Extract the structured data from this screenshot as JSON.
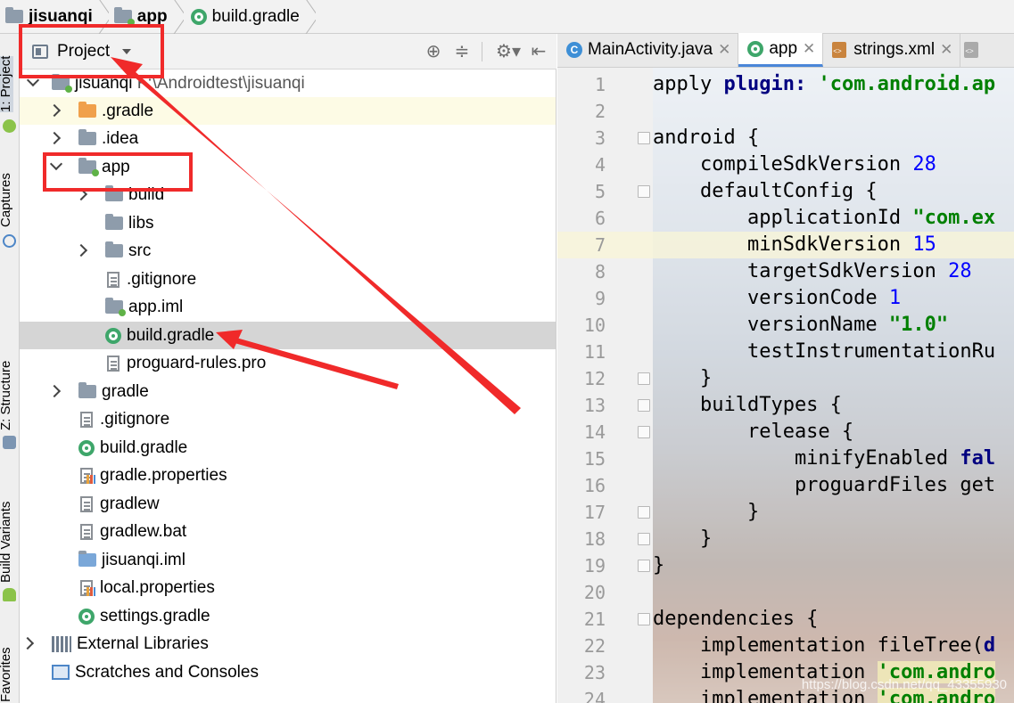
{
  "breadcrumb": [
    "jisuanqi",
    "app",
    "build.gradle"
  ],
  "stripe": {
    "tabs": [
      "1: Project",
      "Captures",
      "Z: Structure",
      "Build Variants",
      "Favorites"
    ]
  },
  "project_panel": {
    "view_selector": "Project",
    "tree": [
      {
        "label": "jisuanqi",
        "path": "F:\\Androidtest\\jisuanqi",
        "icon": "module-folder-icon"
      },
      {
        "label": ".gradle",
        "icon": "folder-orange-icon"
      },
      {
        "label": ".idea",
        "icon": "folder-icon"
      },
      {
        "label": "app",
        "icon": "module-folder-icon"
      },
      {
        "label": "build",
        "icon": "folder-icon"
      },
      {
        "label": "libs",
        "icon": "folder-icon"
      },
      {
        "label": "src",
        "icon": "folder-icon"
      },
      {
        "label": ".gitignore",
        "icon": "text-file-icon"
      },
      {
        "label": "app.iml",
        "icon": "iml-file-icon"
      },
      {
        "label": "build.gradle",
        "icon": "gradle-icon"
      },
      {
        "label": "proguard-rules.pro",
        "icon": "text-file-icon"
      },
      {
        "label": "gradle",
        "icon": "folder-icon"
      },
      {
        "label": ".gitignore",
        "icon": "text-file-icon"
      },
      {
        "label": "build.gradle",
        "icon": "gradle-icon"
      },
      {
        "label": "gradle.properties",
        "icon": "properties-file-icon"
      },
      {
        "label": "gradlew",
        "icon": "text-file-icon"
      },
      {
        "label": "gradlew.bat",
        "icon": "text-file-icon"
      },
      {
        "label": "jisuanqi.iml",
        "icon": "iml-file-icon"
      },
      {
        "label": "local.properties",
        "icon": "properties-file-icon"
      },
      {
        "label": "settings.gradle",
        "icon": "gradle-icon"
      },
      {
        "label": "External Libraries",
        "icon": "libraries-icon"
      },
      {
        "label": "Scratches and Consoles",
        "icon": "scratches-icon"
      }
    ]
  },
  "editor": {
    "tabs": [
      {
        "label": "MainActivity.java",
        "icon": "java-class-icon"
      },
      {
        "label": "app",
        "icon": "gradle-icon"
      },
      {
        "label": "strings.xml",
        "icon": "xml-file-icon"
      }
    ],
    "line_numbers": [
      "1",
      "2",
      "3",
      "4",
      "5",
      "6",
      "7",
      "8",
      "9",
      "10",
      "11",
      "12",
      "13",
      "14",
      "15",
      "16",
      "17",
      "18",
      "19",
      "20",
      "21",
      "22",
      "23",
      "24"
    ],
    "code": {
      "l1_a": "apply ",
      "l1_b": "plugin: ",
      "l1_c": "'com.android.ap",
      "l3": "android {",
      "l4_a": "    compileSdkVersion ",
      "l4_b": "28",
      "l5": "    defaultConfig {",
      "l6_a": "        applicationId ",
      "l6_b": "\"com.ex",
      "l7_a": "        minSdkVersion ",
      "l7_b": "15",
      "l8_a": "        targetSdkVersion ",
      "l8_b": "28",
      "l9_a": "        versionCode ",
      "l9_b": "1",
      "l10_a": "        versionName ",
      "l10_b": "\"1.0\"",
      "l11": "        testInstrumentationRu",
      "l12": "    }",
      "l13": "    buildTypes {",
      "l14": "        release {",
      "l15_a": "            minifyEnabled ",
      "l15_b": "fal",
      "l16": "            proguardFiles get",
      "l17": "        }",
      "l18": "    }",
      "l19": "}",
      "l21": "dependencies {",
      "l22_a": "    implementation fileTree(",
      "l22_b": "d",
      "l23_a": "    implementation ",
      "l23_b": "'com.andro",
      "l24_a": "    implementation ",
      "l24_b": "'com.andro"
    }
  },
  "watermark": "https://blog.csdn.net/qq_43355930",
  "colors": {
    "annotation": "#f02a2a",
    "selection": "#d5d5d5",
    "tab_accent": "#4a86d8",
    "gradle_green": "#3ea66a"
  }
}
